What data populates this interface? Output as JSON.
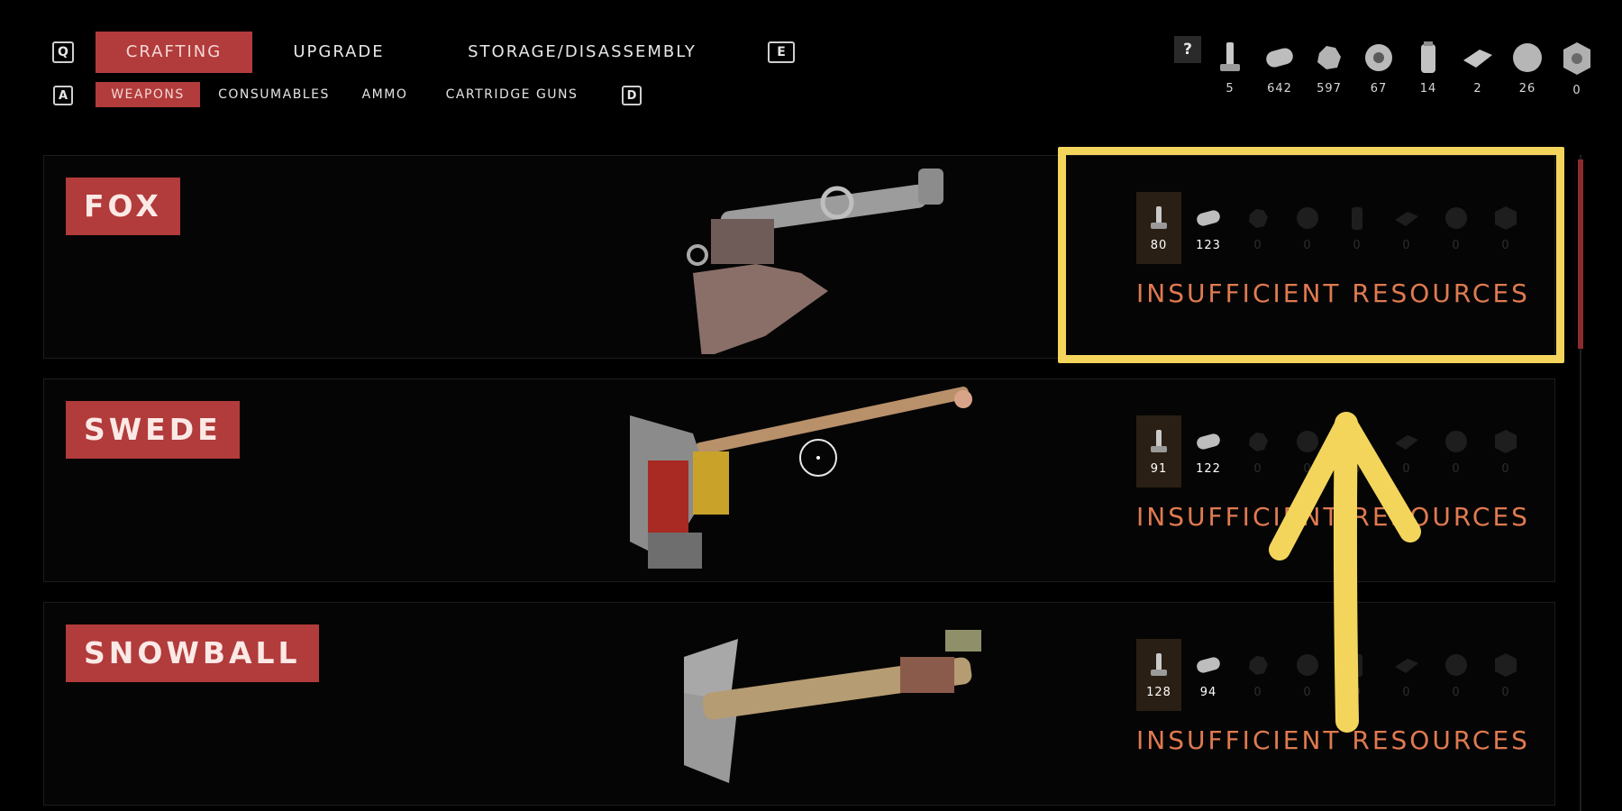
{
  "nav": {
    "key_left": "Q",
    "key_right": "E",
    "tabs": [
      "CRAFTING",
      "UPGRADE",
      "STORAGE/DISASSEMBLY"
    ],
    "active_tab": "CRAFTING"
  },
  "subnav": {
    "key_left": "A",
    "key_right": "D",
    "tabs": [
      "WEAPONS",
      "CONSUMABLES",
      "AMMO",
      "CARTRIDGE GUNS"
    ],
    "active_tab": "WEAPONS"
  },
  "help": "?",
  "resources": [
    {
      "icon": "bolt-icon",
      "count": "5"
    },
    {
      "icon": "pipe-icon",
      "count": "642"
    },
    {
      "icon": "scrap-icon",
      "count": "597"
    },
    {
      "icon": "gear-icon",
      "count": "67"
    },
    {
      "icon": "canister-icon",
      "count": "14"
    },
    {
      "icon": "plate-icon",
      "count": "2"
    },
    {
      "icon": "sphere-icon",
      "count": "26"
    },
    {
      "icon": "core-icon",
      "count": "0"
    }
  ],
  "weapons": [
    {
      "name": "FOX",
      "costs": [
        "80",
        "123",
        "0",
        "0",
        "0",
        "0",
        "0",
        "0"
      ],
      "status": "INSUFFICIENT RESOURCES"
    },
    {
      "name": "SWEDE",
      "costs": [
        "91",
        "122",
        "0",
        "0",
        "0",
        "0",
        "0",
        "0"
      ],
      "status": "INSUFFICIENT RESOURCES"
    },
    {
      "name": "SNOWBALL",
      "costs": [
        "128",
        "94",
        "0",
        "0",
        "0",
        "0",
        "0",
        "0"
      ],
      "status": "INSUFFICIENT RESOURCES"
    }
  ],
  "colors": {
    "accent": "#b23b3b",
    "warning": "#e07a50",
    "annotation": "#f4d55c",
    "background": "#000000"
  }
}
